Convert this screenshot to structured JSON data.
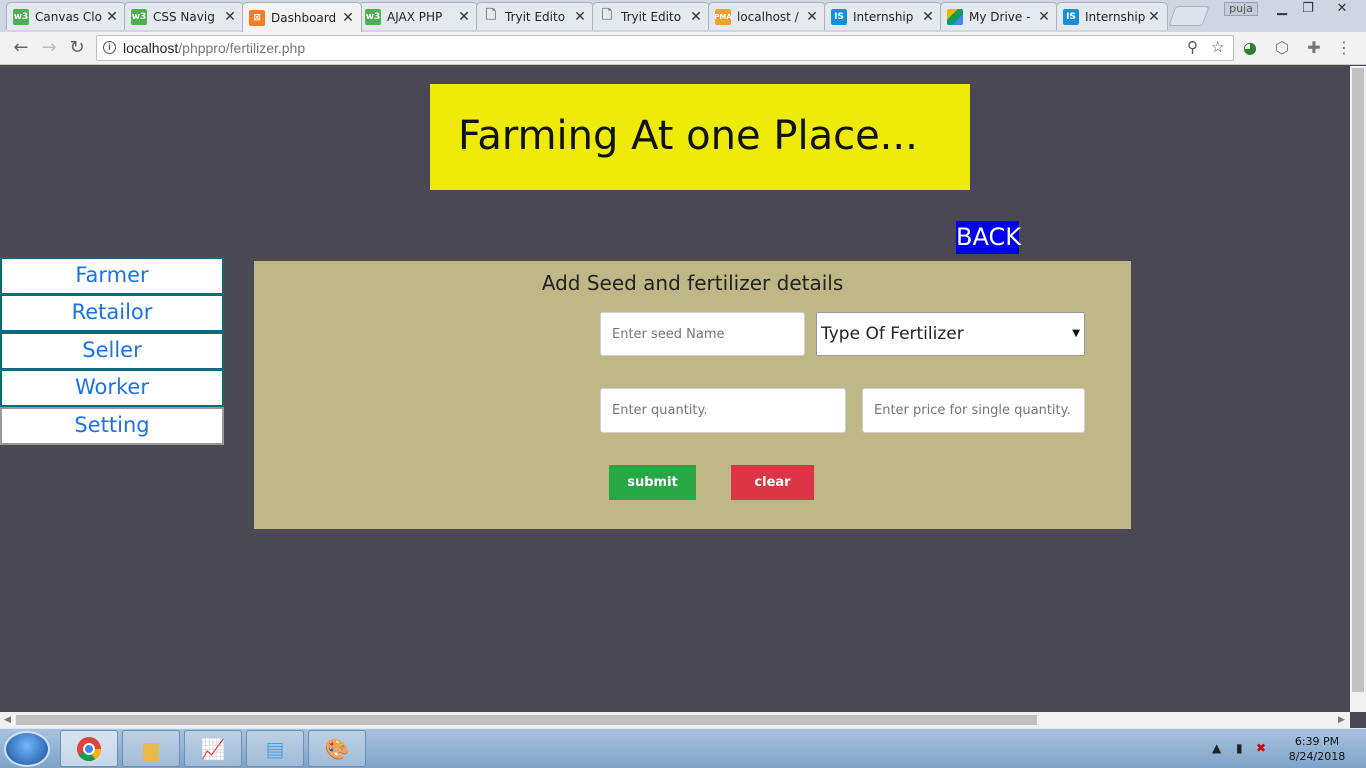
{
  "browser": {
    "tabs": [
      {
        "title": "Canvas Clo",
        "icon": "w3schools-icon",
        "active": false
      },
      {
        "title": "CSS Navig",
        "icon": "w3schools-icon",
        "active": false
      },
      {
        "title": "Dashboard",
        "icon": "xampp-icon",
        "active": true
      },
      {
        "title": "AJAX PHP",
        "icon": "w3schools-icon",
        "active": false
      },
      {
        "title": "Tryit Edito",
        "icon": "document-icon",
        "active": false
      },
      {
        "title": "Tryit Edito",
        "icon": "document-icon",
        "active": false
      },
      {
        "title": "localhost /",
        "icon": "phpmyadmin-icon",
        "active": false
      },
      {
        "title": "Internship",
        "icon": "internshala-icon",
        "active": false
      },
      {
        "title": "My Drive -",
        "icon": "google-drive-icon",
        "active": false
      },
      {
        "title": "Internship",
        "icon": "internshala-icon",
        "active": false
      }
    ],
    "profile_name": "puja",
    "address": {
      "host": "localhost",
      "path": "/phppro/fertilizer.php"
    }
  },
  "page": {
    "banner_title": "Farming At one Place...",
    "back_label": "BACK",
    "sidebar": [
      {
        "label": "Farmer"
      },
      {
        "label": "Retailor"
      },
      {
        "label": "Seller"
      },
      {
        "label": "Worker"
      },
      {
        "label": "Setting"
      }
    ],
    "form": {
      "title": "Add Seed and fertilizer details",
      "seed_placeholder": "Enter seed Name",
      "fertilizer_type_selected": "Type Of Fertilizer",
      "quantity_placeholder": "Enter quantity.",
      "price_placeholder": "Enter price for single quantity.",
      "submit_label": "submit",
      "clear_label": "clear"
    }
  },
  "colors": {
    "page_bg": "#4a4953",
    "banner_bg": "#eeeb09",
    "back_bg": "#0000ee",
    "panel_bg": "#bfb786",
    "submit_bg": "#28a745",
    "clear_bg": "#dc3545",
    "sidebar_text": "#1a73e8"
  },
  "taskbar": {
    "time": "6:39 PM",
    "date": "8/24/2018"
  }
}
